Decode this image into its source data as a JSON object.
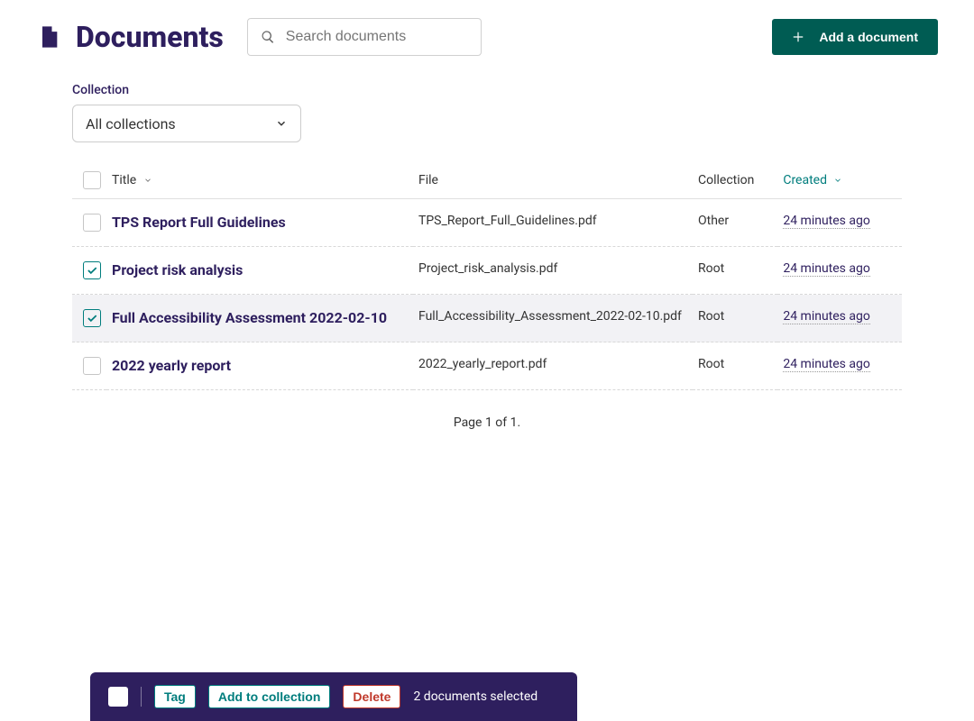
{
  "header": {
    "title": "Documents",
    "search_placeholder": "Search documents",
    "add_button": "Add a document"
  },
  "filter": {
    "label": "Collection",
    "selected": "All collections"
  },
  "columns": {
    "title": "Title",
    "file": "File",
    "collection": "Collection",
    "created": "Created"
  },
  "rows": [
    {
      "checked": false,
      "title": "TPS Report Full Guidelines",
      "file": "TPS_Report_Full_Guidelines.pdf",
      "collection": "Other",
      "created": "24 minutes ago",
      "highlight": false
    },
    {
      "checked": true,
      "title": "Project risk analysis",
      "file": "Project_risk_analysis.pdf",
      "collection": "Root",
      "created": "24 minutes ago",
      "highlight": false
    },
    {
      "checked": true,
      "title": "Full Accessibility Assessment 2022-02-10",
      "file": "Full_Accessibility_Assessment_2022-02-10.pdf",
      "collection": "Root",
      "created": "24 minutes ago",
      "highlight": true
    },
    {
      "checked": false,
      "title": "2022 yearly report",
      "file": "2022_yearly_report.pdf",
      "collection": "Root",
      "created": "24 minutes ago",
      "highlight": false
    }
  ],
  "pagination": "Page 1 of 1.",
  "bulk": {
    "tag": "Tag",
    "add_collection": "Add to collection",
    "delete": "Delete",
    "status": "2 documents selected"
  }
}
